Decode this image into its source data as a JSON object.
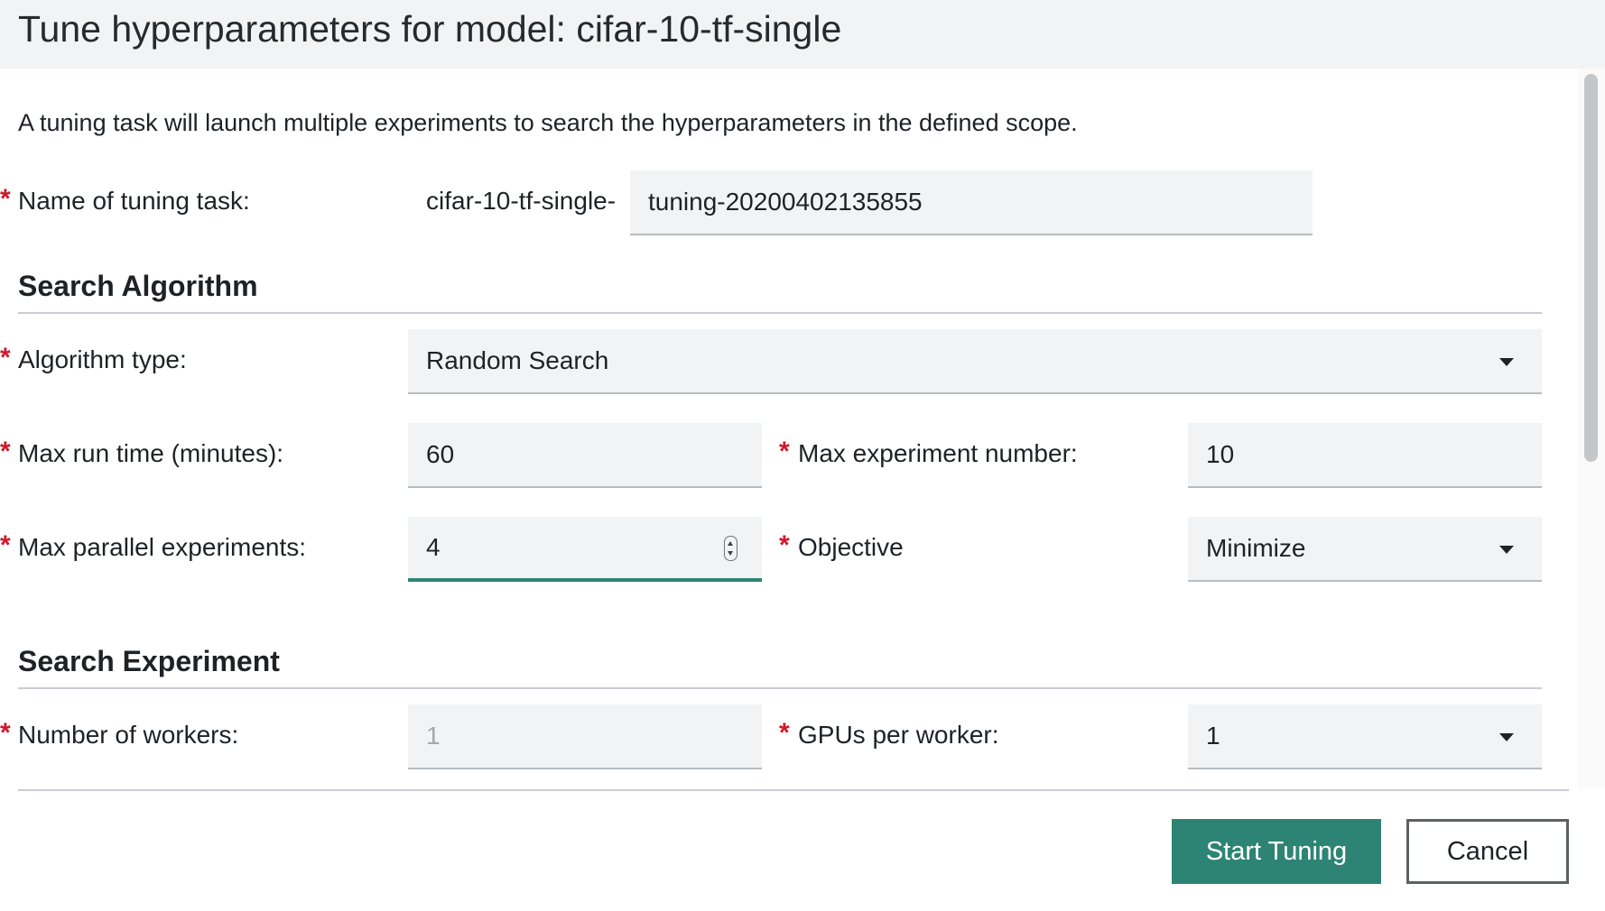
{
  "dialog": {
    "title": "Tune hyperparameters for model: cifar-10-tf-single"
  },
  "intro": {
    "description": "A tuning task will launch multiple experiments to search the hyperparameters in the defined scope."
  },
  "name_field": {
    "label": "Name of tuning task:",
    "prefix": "cifar-10-tf-single-",
    "value": "tuning-20200402135855"
  },
  "search_algorithm": {
    "heading": "Search Algorithm",
    "algorithm_type": {
      "label": "Algorithm type:",
      "value": "Random Search"
    },
    "max_run_time": {
      "label": "Max run time (minutes):",
      "value": "60"
    },
    "max_experiment_number": {
      "label": "Max experiment number:",
      "value": "10"
    },
    "max_parallel": {
      "label": "Max parallel experiments:",
      "value": "4"
    },
    "objective": {
      "label": "Objective",
      "value": "Minimize"
    }
  },
  "search_experiment": {
    "heading": "Search Experiment",
    "num_workers": {
      "label": "Number of workers:",
      "value": "1"
    },
    "gpus_per_worker": {
      "label": "GPUs per worker:",
      "value": "1"
    }
  },
  "required_marker": "*",
  "footer": {
    "start_label": "Start Tuning",
    "cancel_label": "Cancel"
  },
  "colors": {
    "accent": "#2e8474",
    "required": "#d0182a",
    "field_bg": "#f2f3f4"
  },
  "icons": {
    "dropdown": "chevron-down-icon",
    "stepper": "number-stepper-icon"
  }
}
